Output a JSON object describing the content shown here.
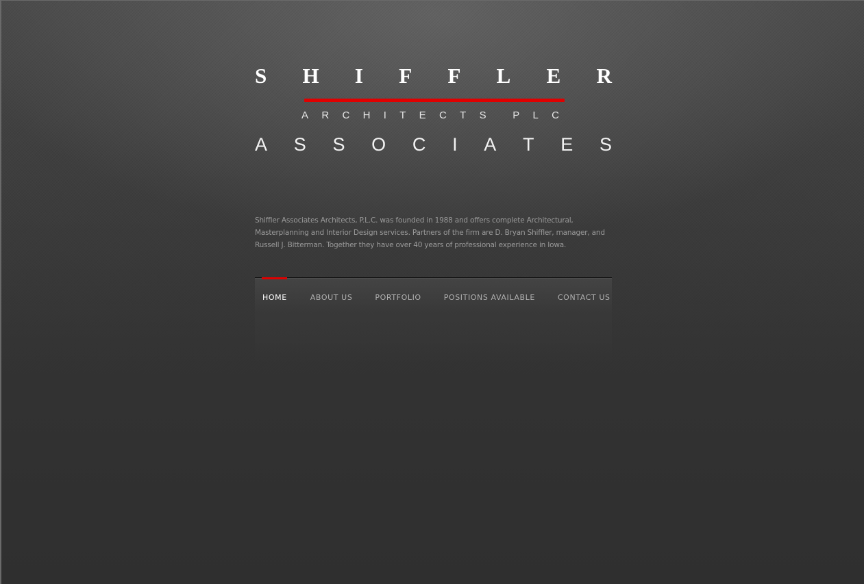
{
  "logo": {
    "line1": [
      "S",
      "H",
      "I",
      "F",
      "F",
      "L",
      "E",
      "R"
    ],
    "line2": [
      "A",
      "R",
      "C",
      "H",
      "I",
      "T",
      "E",
      "C",
      "T",
      "S",
      " ",
      "P",
      "L",
      "C"
    ],
    "line3": [
      "A",
      "S",
      "S",
      "O",
      "C",
      "I",
      "A",
      "T",
      "E",
      "S"
    ],
    "accent_color": "#e00000"
  },
  "intro": {
    "lines": [
      "Shiffler Associates Architects, P.L.C. was founded in 1988 and offers complete Architectural,",
      "Masterplanning and Interior Design services. Partners of the firm are D. Bryan Shiffler, manager, and",
      "Russell J. Bitterman. Together they have over 40 years of professional experience in Iowa."
    ]
  },
  "nav": {
    "items": [
      {
        "label": "HOME",
        "active": true
      },
      {
        "label": "ABOUT US",
        "active": false
      },
      {
        "label": "PORTFOLIO",
        "active": false
      },
      {
        "label": "POSITIONS AVAILABLE",
        "active": false
      },
      {
        "label": "CONTACT US",
        "active": false
      }
    ],
    "active_color": "#e00000"
  }
}
